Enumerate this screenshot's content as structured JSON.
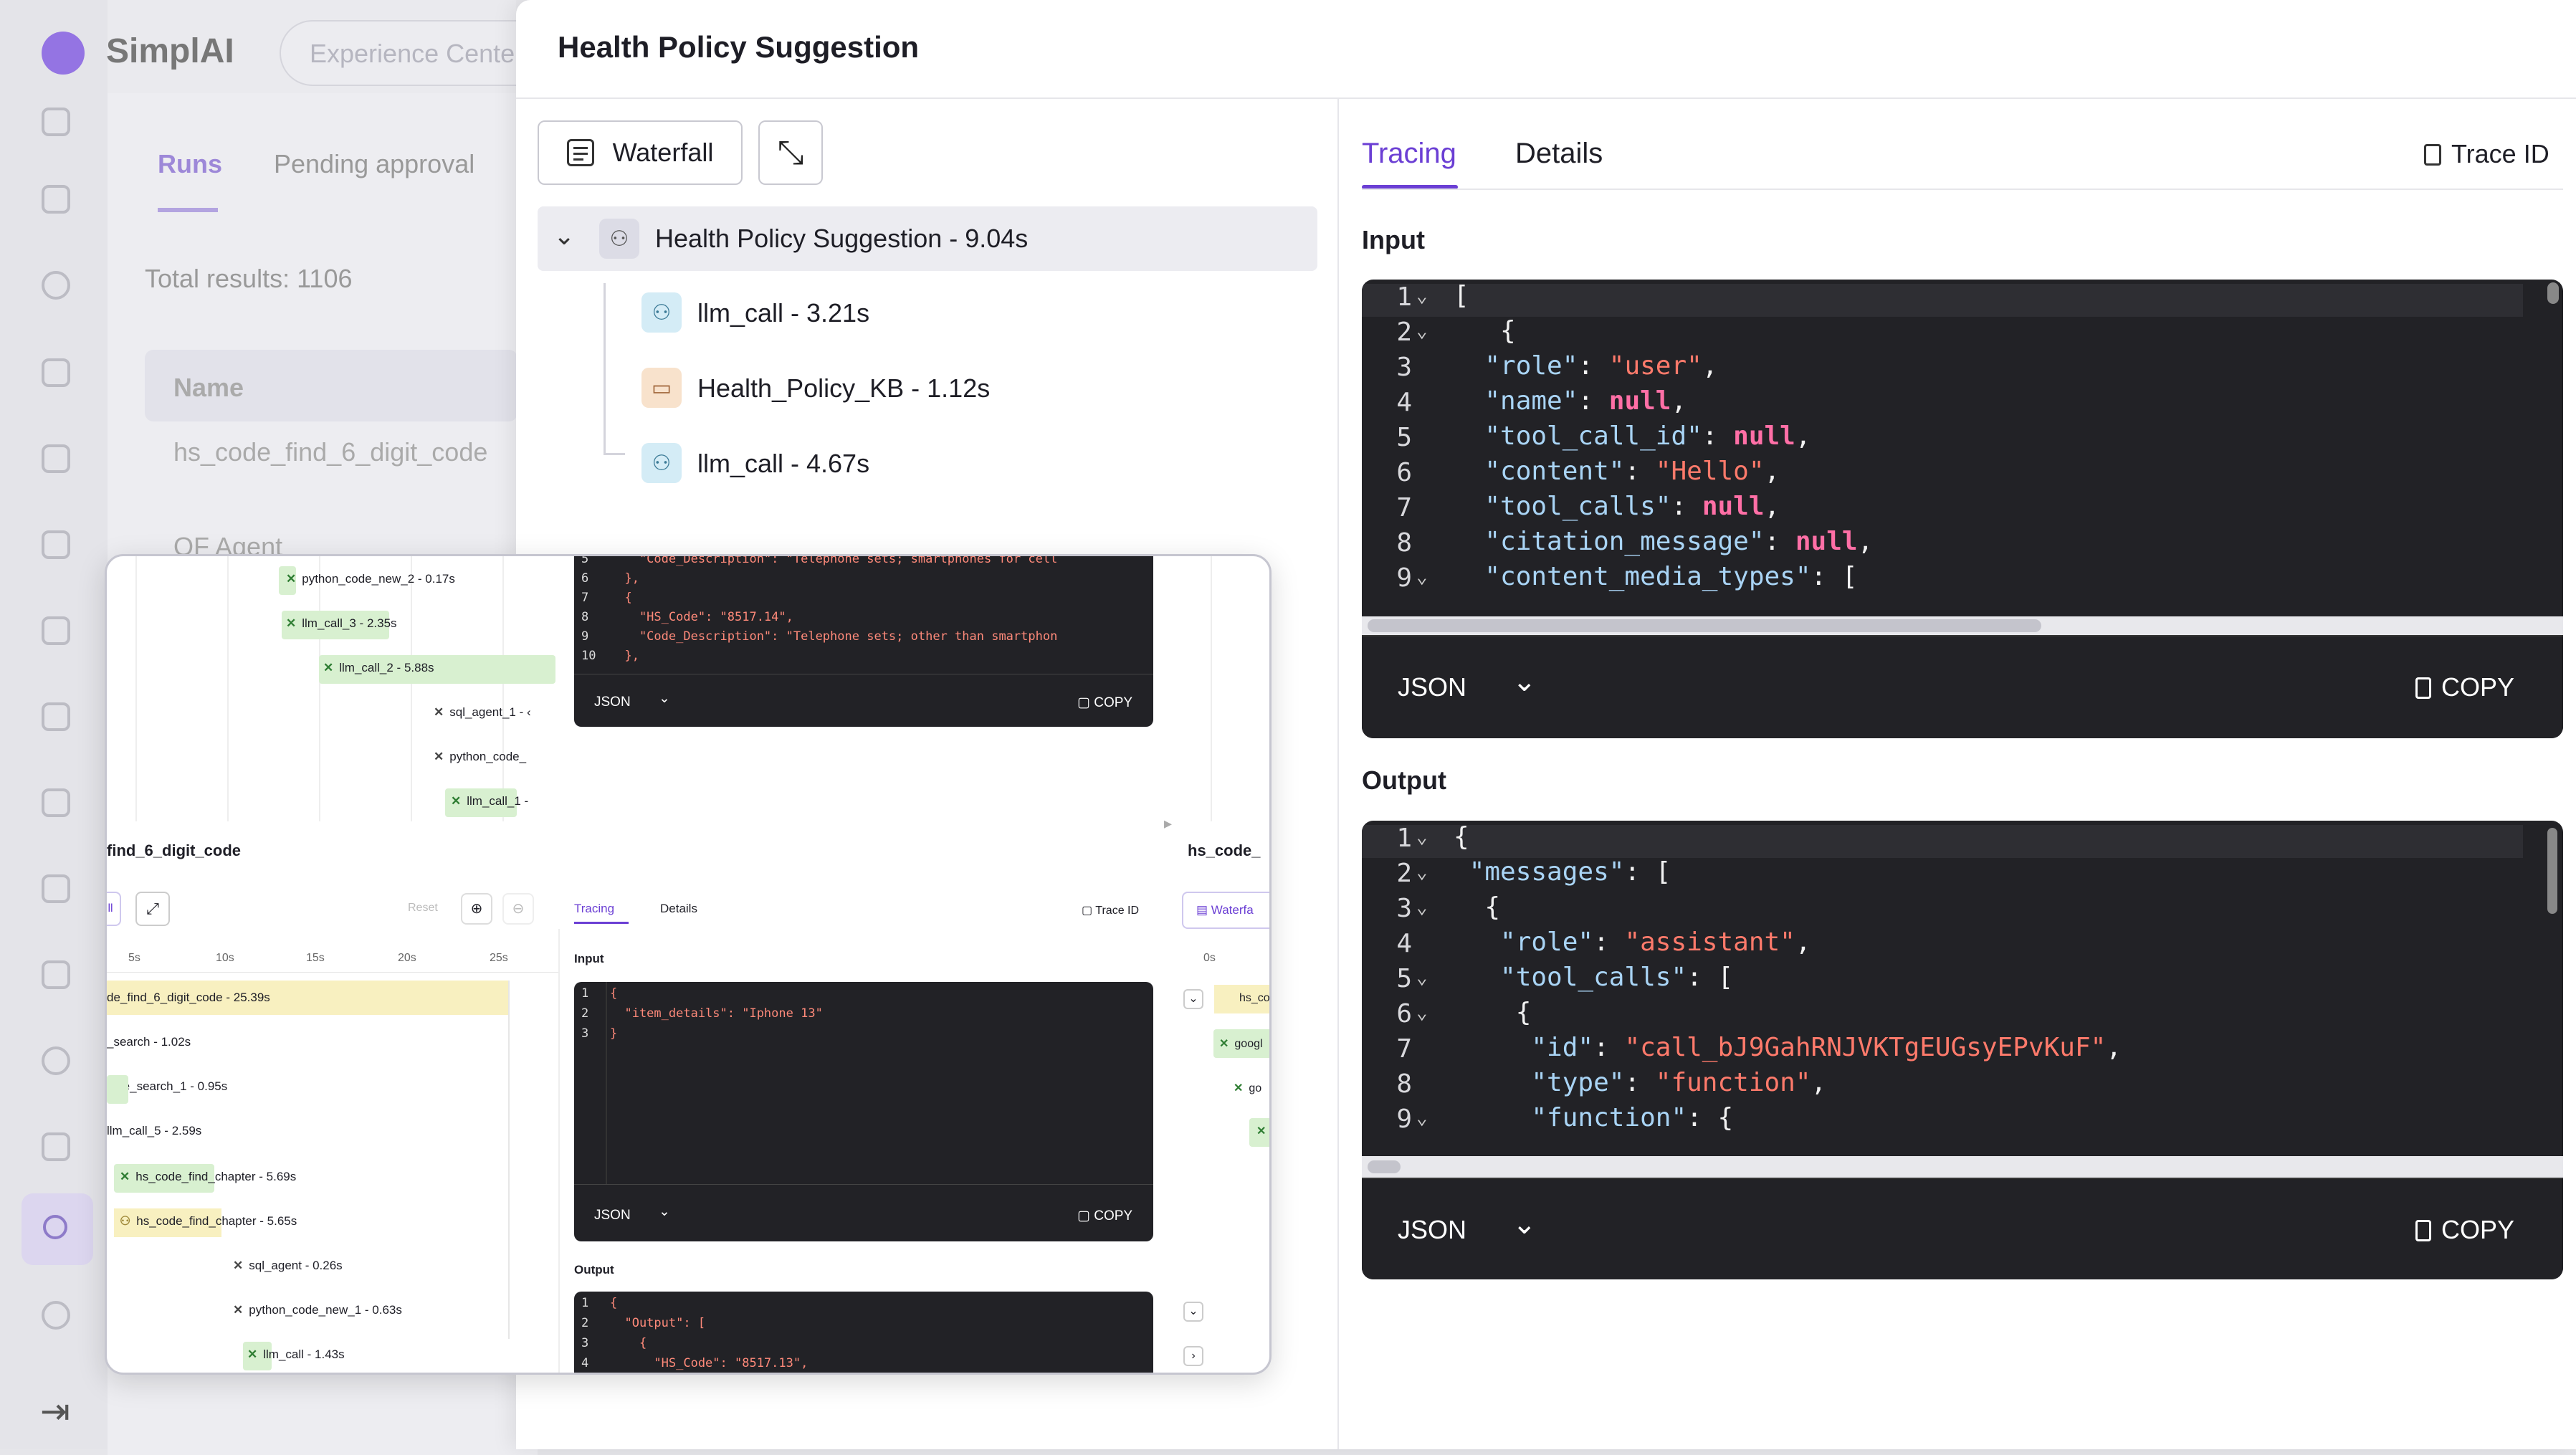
{
  "background_app": {
    "brand": "SimplAI",
    "search_placeholder": "Experience Cente",
    "tabs": [
      "Runs",
      "Pending approval"
    ],
    "total_results": "Total results: 1106",
    "name_column": "Name",
    "rows": [
      "hs_code_find_6_digit_code",
      "OF Agent"
    ]
  },
  "drawer": {
    "title": "Health Policy Suggestion",
    "waterfall_button": "Waterfall",
    "tree": {
      "root": "Health Policy Suggestion - 9.04s",
      "children": [
        {
          "label": "llm_call - 3.21s",
          "icon": "agent-icon"
        },
        {
          "label": "Health_Policy_KB - 1.12s",
          "icon": "folder-icon"
        },
        {
          "label": "llm_call - 4.67s",
          "icon": "agent-icon"
        }
      ]
    },
    "tabs": [
      "Tracing",
      "Details"
    ],
    "active_tab": "Tracing",
    "trace_id_label": "Trace ID",
    "input_label": "Input",
    "output_label": "Output",
    "format_label": "JSON",
    "copy_label": "COPY",
    "input_lines": [
      {
        "n": "1",
        "fold": true,
        "text": "["
      },
      {
        "n": "2",
        "fold": true,
        "text": "  {"
      },
      {
        "n": "3",
        "fold": false,
        "key": "\"role\"",
        "val": "\"user\"",
        "vt": "s"
      },
      {
        "n": "4",
        "fold": false,
        "key": "\"name\"",
        "val": "null",
        "vt": "n"
      },
      {
        "n": "5",
        "fold": false,
        "key": "\"tool_call_id\"",
        "val": "null",
        "vt": "n"
      },
      {
        "n": "6",
        "fold": false,
        "key": "\"content\"",
        "val": "\"Hello\"",
        "vt": "s"
      },
      {
        "n": "7",
        "fold": false,
        "key": "\"tool_calls\"",
        "val": "null",
        "vt": "n"
      },
      {
        "n": "8",
        "fold": false,
        "key": "\"citation_message\"",
        "val": "null",
        "vt": "n"
      },
      {
        "n": "9",
        "fold": true,
        "key": "\"content_media_types\"",
        "val": "[",
        "vt": "p"
      }
    ],
    "output_lines": [
      {
        "n": "1",
        "fold": true,
        "indent": 0,
        "text": "{"
      },
      {
        "n": "2",
        "fold": true,
        "indent": 1,
        "key": "\"messages\"",
        "val": "[",
        "vt": "p"
      },
      {
        "n": "3",
        "fold": true,
        "indent": 2,
        "text": "{"
      },
      {
        "n": "4",
        "fold": false,
        "indent": 3,
        "key": "\"role\"",
        "val": "\"assistant\"",
        "vt": "s"
      },
      {
        "n": "5",
        "fold": true,
        "indent": 3,
        "key": "\"tool_calls\"",
        "val": "[",
        "vt": "p"
      },
      {
        "n": "6",
        "fold": true,
        "indent": 4,
        "text": "{"
      },
      {
        "n": "7",
        "fold": false,
        "indent": 5,
        "key": "\"id\"",
        "val": "\"call_bJ9GahRNJVKTgEUGsyEPvKuF\"",
        "vt": "s"
      },
      {
        "n": "8",
        "fold": false,
        "indent": 5,
        "key": "\"type\"",
        "val": "\"function\"",
        "vt": "s"
      },
      {
        "n": "9",
        "fold": true,
        "indent": 5,
        "key": "\"function\"",
        "val": "{",
        "vt": "p"
      }
    ]
  },
  "overlay": {
    "waterfall_items": [
      "python_code_new_2 - 0.17s",
      "llm_call_3 - 2.35s",
      "llm_call_2 - 5.88s",
      "sql_agent_1 - ‹",
      "python_code_",
      "llm_call_1 -"
    ],
    "trace_title_left": "find_6_digit_code",
    "trace_title_right": "hs_code_",
    "reset_label": "Reset",
    "timeline_ticks": [
      "5s",
      "10s",
      "15s",
      "20s",
      "25s"
    ],
    "timeline_right_tick": "0s",
    "bars": [
      "de_find_6_digit_code - 25.39s",
      "_search - 1.02s",
      "ogle_search_1 - 0.95s",
      "llm_call_5 - 2.59s",
      "hs_code_find_chapter - 5.69s",
      "hs_code_find_chapter - 5.65s",
      "sql_agent - 0.26s",
      "python_code_new_1 - 0.63s",
      "llm_call - 1.43s"
    ],
    "tabs": [
      "Tracing",
      "Details"
    ],
    "trace_id_label": "Trace ID",
    "waterfall_label": "Waterfa",
    "input_label": "Input",
    "output_label": "Output",
    "format_label": "JSON",
    "copy_label": "COPY",
    "top_code_lines": [
      {
        "n": "5",
        "text": "    \"Code_Description\": \"Telephone sets; smartphones for cell"
      },
      {
        "n": "6",
        "text": "  },"
      },
      {
        "n": "7",
        "text": "  {"
      },
      {
        "n": "8",
        "text": "    \"HS_Code\": \"8517.14\","
      },
      {
        "n": "9",
        "text": "    \"Code_Description\": \"Telephone sets; other than smartphon"
      },
      {
        "n": "10",
        "text": "  },"
      }
    ],
    "input_code_lines": [
      {
        "n": "1",
        "text": "{"
      },
      {
        "n": "2",
        "text": "  \"item_details\": \"Iphone 13\""
      },
      {
        "n": "3",
        "text": "}"
      }
    ],
    "output_code_lines": [
      {
        "n": "1",
        "text": "{"
      },
      {
        "n": "2",
        "text": "  \"Output\": ["
      },
      {
        "n": "3",
        "text": "    {"
      },
      {
        "n": "4",
        "text": "      \"HS_Code\": \"8517.13\","
      }
    ],
    "right_items": [
      "hs_co",
      "googl",
      "go"
    ]
  },
  "colors": {
    "accent": "#6b3fd4",
    "code_bg": "#222226",
    "tree_selected": "#ececf1",
    "string": "#ff7a6b",
    "null": "#ff6fa6",
    "key": "#a9d4f5"
  }
}
